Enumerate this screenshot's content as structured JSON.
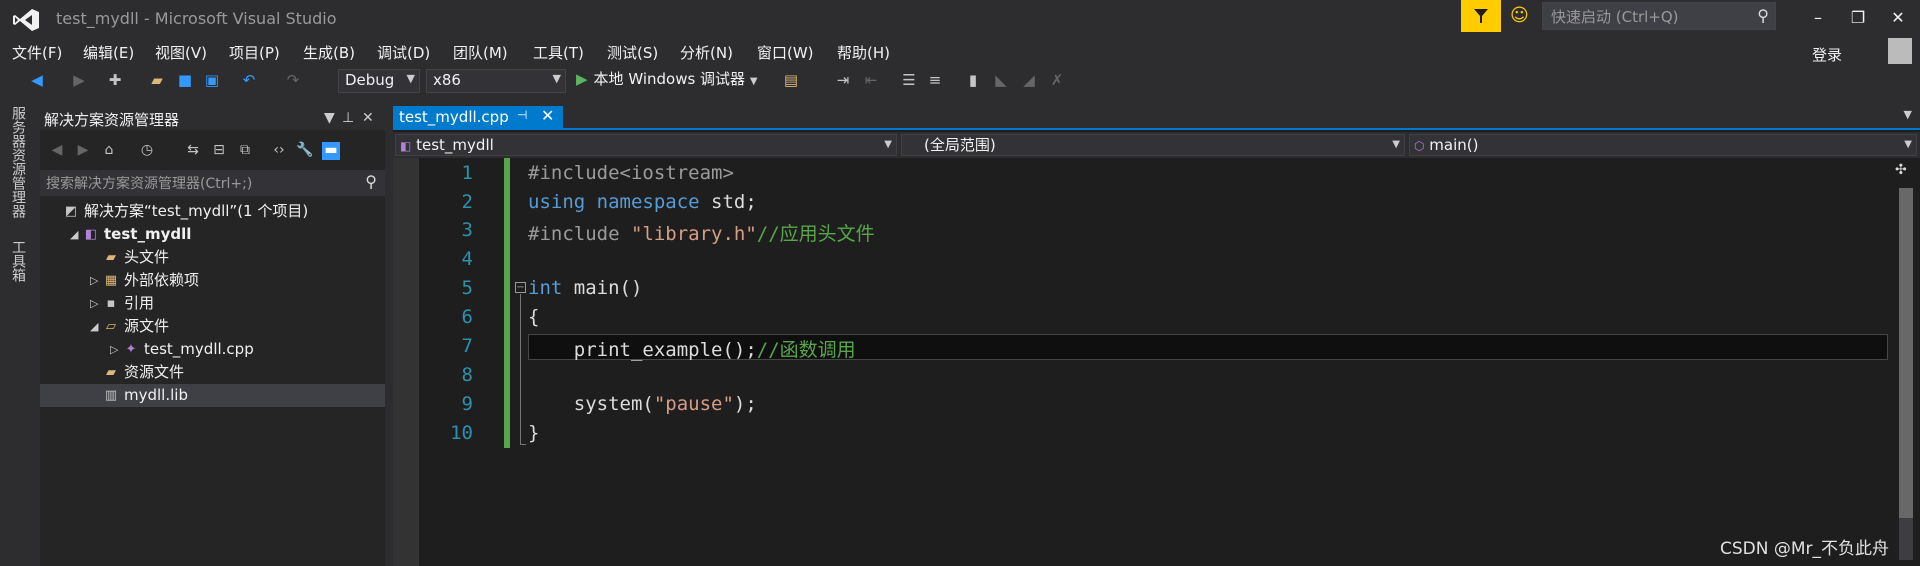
{
  "window": {
    "title": "test_mydll - Microsoft Visual Studio",
    "quick_launch_placeholder": "快速启动 (Ctrl+Q)",
    "login": "登录",
    "controls": {
      "minimize": "–",
      "restore": "❐",
      "close": "✕"
    }
  },
  "menu": [
    "文件(F)",
    "编辑(E)",
    "视图(V)",
    "项目(P)",
    "生成(B)",
    "调试(D)",
    "团队(M)",
    "工具(T)",
    "测试(S)",
    "分析(N)",
    "窗口(W)",
    "帮助(H)"
  ],
  "toolbar": {
    "config": "Debug",
    "platform": "x86",
    "run_label": "本地 Windows 调试器"
  },
  "side_tabs": [
    "服务器资源管理器",
    "工具箱"
  ],
  "solution_explorer": {
    "title": "解决方案资源管理器",
    "search_placeholder": "搜索解决方案资源管理器(Ctrl+;)",
    "tree": [
      {
        "label": "解决方案“test_mydll”(1 个项目)",
        "depth": 0,
        "icon": "solution-icon",
        "expander": ""
      },
      {
        "label": "test_mydll",
        "depth": 1,
        "icon": "cpp-project-icon",
        "expander": "◢",
        "bold": true
      },
      {
        "label": "头文件",
        "depth": 2,
        "icon": "folder-icon",
        "expander": ""
      },
      {
        "label": "外部依赖项",
        "depth": 2,
        "icon": "external-deps-icon",
        "expander": "▷"
      },
      {
        "label": "引用",
        "depth": 2,
        "icon": "references-icon",
        "expander": "▷"
      },
      {
        "label": "源文件",
        "depth": 2,
        "icon": "folder-open-icon",
        "expander": "◢"
      },
      {
        "label": "test_mydll.cpp",
        "depth": 3,
        "icon": "cpp-file-icon",
        "expander": "▷"
      },
      {
        "label": "资源文件",
        "depth": 2,
        "icon": "folder-icon",
        "expander": ""
      },
      {
        "label": "mydll.lib",
        "depth": 2,
        "icon": "lib-file-icon",
        "expander": "",
        "selected": true
      }
    ]
  },
  "editor": {
    "tab_label": "test_mydll.cpp",
    "nav_project": "test_mydll",
    "nav_scope": "(全局范围)",
    "nav_member": "main()",
    "line_numbers": [
      "1",
      "2",
      "3",
      "4",
      "5",
      "6",
      "7",
      "8",
      "9",
      "10"
    ],
    "code": {
      "l1": "#include<iostream>",
      "l2_kw": "using namespace",
      "l2_rest": " std;",
      "l3_pp": "#include ",
      "l3_str": "\"library.h\"",
      "l3_cm": "//应用头文件",
      "l5_kw": "int",
      "l5_rest": " main()",
      "l6": "{",
      "l7_code": "    print_example();",
      "l7_cm": "//函数调用",
      "l9_a": "    system(",
      "l9_str": "\"pause\"",
      "l9_b": ");",
      "l10": "}"
    }
  },
  "watermark": "CSDN @Mr_不负此舟",
  "colors": {
    "accent": "#007acc",
    "notify": "#ffcc00",
    "keyword": "#569cd6",
    "comment": "#57a64a",
    "string": "#d69d85"
  }
}
